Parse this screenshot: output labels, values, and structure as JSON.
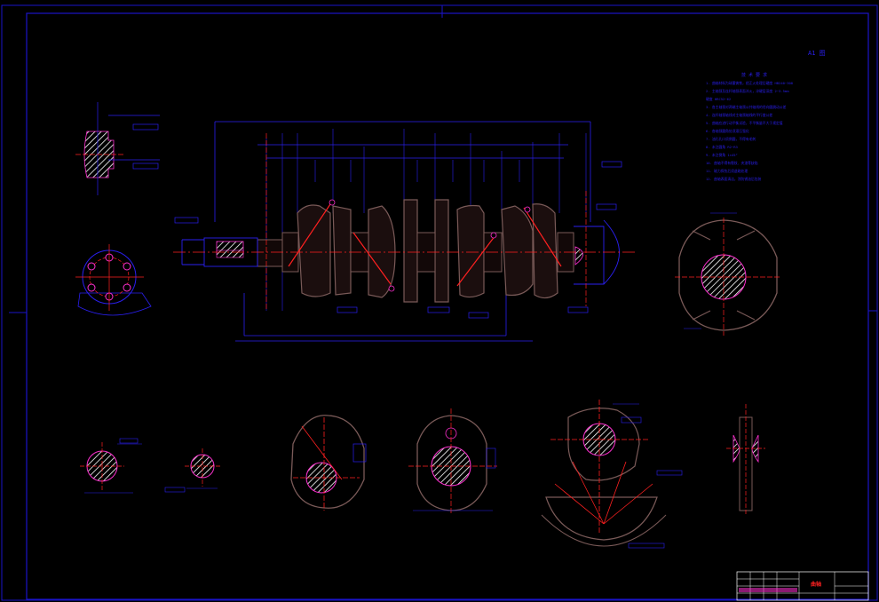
{
  "drawing": {
    "sheet_label": "A1 图",
    "colors": {
      "background": "#000000",
      "outline": "#2a1ff0",
      "section": "#7a5a58",
      "centerline": "#ff2020",
      "highlight": "#ff2fd0",
      "hatch": "#ffffff",
      "frame": "#1a14c8"
    }
  },
  "notes": {
    "heading": "技 术 要 求",
    "lines": [
      "1. 曲轴材料为球墨铸铁，经正火处理后硬度 HB240~300",
      "2. 主轴颈及连杆轴颈表面淬火，淬硬层深度 2~3.5mm",
      "   硬度 HRC52~62",
      "3. 各主轴颈对两端主轴颈公共轴线的径向圆跳动公差",
      "4. 连杆轴颈轴线对主轴颈轴线的平行度公差",
      "5. 曲轴应进行动平衡试验，不平衡量不大于规定值",
      "6. 各轴颈圆角处须滚压强化",
      "7. 油孔孔口须倒圆，不得有毛刺",
      "8. 未注圆角 R2~R3",
      "9. 未注倒角 1×45°",
      "10. 曲轴不得有裂纹、夹渣等缺陷",
      "11. 磁力探伤后须退磁处理",
      "12. 曲轴表面清洁，涂防锈油后包装"
    ]
  },
  "title_block": {
    "part_name": "曲轴"
  }
}
